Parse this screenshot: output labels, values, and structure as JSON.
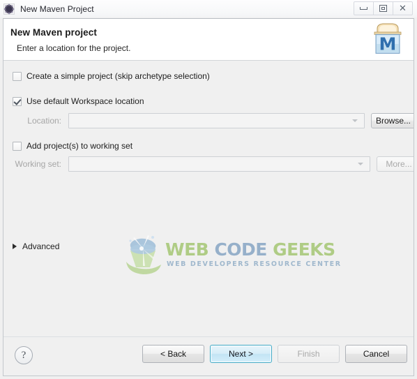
{
  "window": {
    "title": "New Maven Project",
    "icon": "maven-window-icon",
    "controls": {
      "minimize": "minimize-icon",
      "maximize": "restore-icon",
      "close": "close-icon",
      "close_glyph": "✕"
    }
  },
  "header": {
    "title": "New Maven project",
    "subtitle": "Enter a location for the project.",
    "logo": "maven-banner-icon",
    "logo_letter": "M"
  },
  "body": {
    "simple_project": {
      "label": "Create a simple project (skip archetype selection)",
      "checked": false
    },
    "default_workspace": {
      "label": "Use default Workspace location",
      "checked": true
    },
    "location": {
      "label": "Location:",
      "value": "",
      "placeholder": "",
      "enabled": false,
      "browse_label": "Browse...",
      "browse_enabled": true
    },
    "working_set_checkbox": {
      "label": "Add project(s) to working set",
      "checked": false
    },
    "working_set": {
      "label": "Working set:",
      "value": "",
      "placeholder": "",
      "enabled": false,
      "more_label": "More...",
      "more_enabled": false
    },
    "advanced": {
      "label": "Advanced",
      "expanded": false
    },
    "watermark": {
      "word1": "WEB",
      "word2": "CODE",
      "word3": "GEEKS",
      "tagline": "WEB DEVELOPERS RESOURCE CENTER",
      "color_green": "#9ec368",
      "color_blue": "#7e9fc0"
    }
  },
  "footer": {
    "help_label": "?",
    "back_label": "< Back",
    "next_label": "Next >",
    "finish_label": "Finish",
    "cancel_label": "Cancel"
  }
}
